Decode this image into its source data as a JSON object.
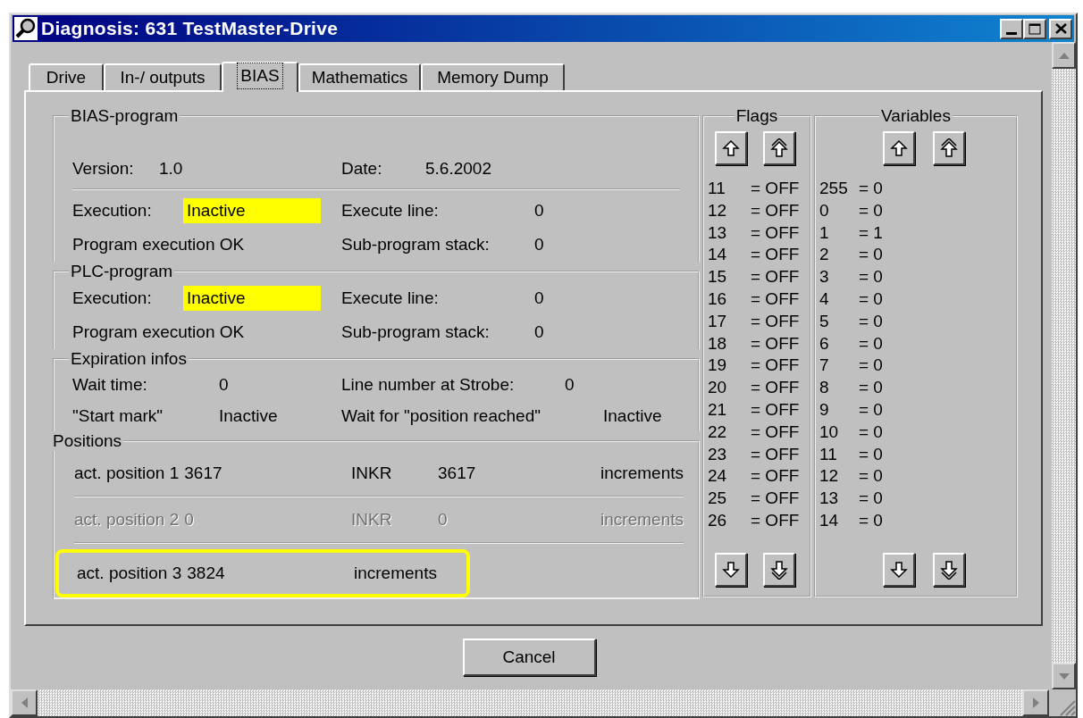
{
  "window": {
    "title": "Diagnosis: 631 TestMaster-Drive"
  },
  "tabs": [
    {
      "label": "Drive",
      "selected": false
    },
    {
      "label": "In-/ outputs",
      "selected": false
    },
    {
      "label": "BIAS",
      "selected": true
    },
    {
      "label": "Mathematics",
      "selected": false
    },
    {
      "label": "Memory Dump",
      "selected": false
    }
  ],
  "bias_program": {
    "legend": "BIAS-program",
    "version_label": "Version:",
    "version": "1.0",
    "date_label": "Date:",
    "date": "5.6.2002",
    "execution_label": "Execution:",
    "execution": "Inactive",
    "execution_highlighted": true,
    "status": "Program execution OK",
    "execute_line_label": "Execute line:",
    "execute_line": "0",
    "stack_label": "Sub-program stack:",
    "stack": "0"
  },
  "plc_program": {
    "legend": "PLC-program",
    "execution_label": "Execution:",
    "execution": "Inactive",
    "execution_highlighted": true,
    "status": "Program execution OK",
    "execute_line_label": "Execute line:",
    "execute_line": "0",
    "stack_label": "Sub-program stack:",
    "stack": "0"
  },
  "expiration_infos": {
    "legend": "Expiration infos",
    "wait_time_label": "Wait time:",
    "wait_time": "0",
    "strobe_label": "Line number at Strobe:",
    "strobe": "0",
    "start_mark_label": "\"Start mark\"",
    "start_mark": "Inactive",
    "wait_position_label": "Wait for \"position reached\"",
    "wait_position": "Inactive"
  },
  "positions": {
    "legend": "Positions",
    "rows": [
      {
        "name": "act. position 1",
        "value": "3617",
        "inkr_label": "INKR",
        "inkr_value": "3617",
        "unit": "increments",
        "disabled": false,
        "highlighted": false
      },
      {
        "name": "act. position 2",
        "value": "0",
        "inkr_label": "INKR",
        "inkr_value": "0",
        "unit": "increments",
        "disabled": true,
        "highlighted": false
      },
      {
        "name": "act. position 3",
        "value": "3824",
        "unit": "increments",
        "disabled": false,
        "highlighted": true
      }
    ]
  },
  "flags": {
    "legend": "Flags",
    "items": [
      {
        "number": "11",
        "value": "= OFF"
      },
      {
        "number": "12",
        "value": "= OFF"
      },
      {
        "number": "13",
        "value": "= OFF"
      },
      {
        "number": "14",
        "value": "= OFF"
      },
      {
        "number": "15",
        "value": "= OFF"
      },
      {
        "number": "16",
        "value": "= OFF"
      },
      {
        "number": "17",
        "value": "= OFF"
      },
      {
        "number": "18",
        "value": "= OFF"
      },
      {
        "number": "19",
        "value": "= OFF"
      },
      {
        "number": "20",
        "value": "= OFF"
      },
      {
        "number": "21",
        "value": "= OFF"
      },
      {
        "number": "22",
        "value": "= OFF"
      },
      {
        "number": "23",
        "value": "= OFF"
      },
      {
        "number": "24",
        "value": "= OFF"
      },
      {
        "number": "25",
        "value": "= OFF"
      },
      {
        "number": "26",
        "value": "= OFF"
      }
    ]
  },
  "variables": {
    "legend": "Variables",
    "items": [
      {
        "number": "255",
        "value": "= 0"
      },
      {
        "number": "0",
        "value": "= 0"
      },
      {
        "number": "1",
        "value": "= 1"
      },
      {
        "number": "2",
        "value": "= 0"
      },
      {
        "number": "3",
        "value": "= 0"
      },
      {
        "number": "4",
        "value": "= 0"
      },
      {
        "number": "5",
        "value": "= 0"
      },
      {
        "number": "6",
        "value": "= 0"
      },
      {
        "number": "7",
        "value": "= 0"
      },
      {
        "number": "8",
        "value": "= 0"
      },
      {
        "number": "9",
        "value": "= 0"
      },
      {
        "number": "10",
        "value": "= 0"
      },
      {
        "number": "11",
        "value": "= 0"
      },
      {
        "number": "12",
        "value": "= 0"
      },
      {
        "number": "13",
        "value": "= 0"
      },
      {
        "number": "14",
        "value": "= 0"
      }
    ]
  },
  "buttons": [
    {
      "label": "Cancel"
    }
  ]
}
